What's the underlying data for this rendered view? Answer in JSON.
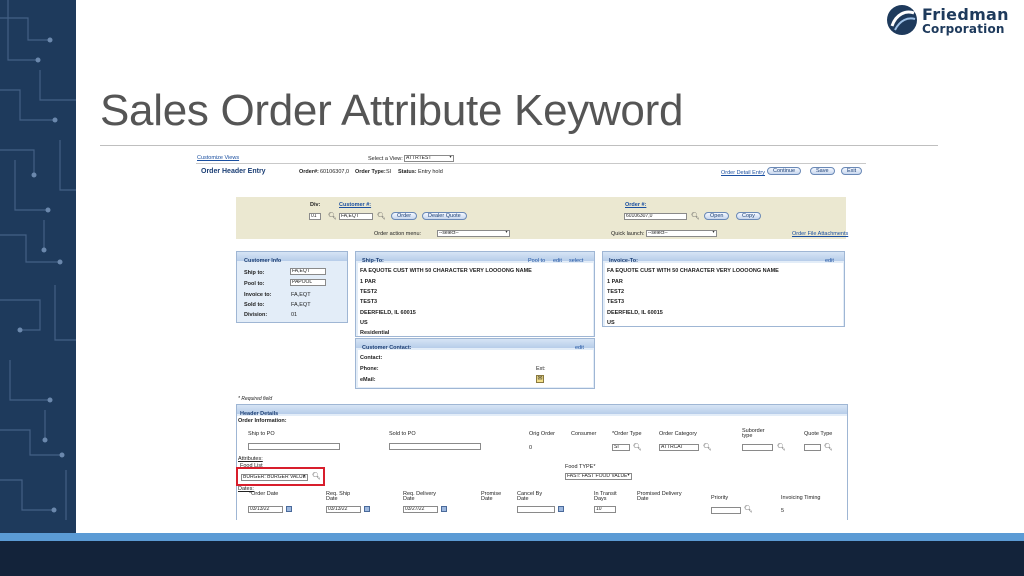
{
  "slide": {
    "title": "Sales Order Attribute Keyword",
    "logo_line1": "Friedman",
    "logo_line2": "Corporation",
    "colors": {
      "band": "#1e3a5c",
      "accent": "#5b9bd5",
      "footer": "#13233a",
      "highlight": "#d81e2c"
    }
  },
  "topbar": {
    "customize_views": "Customize Views",
    "select_view_label": "Select a View:",
    "select_view_value": "ATTRTEST"
  },
  "header": {
    "title": "Order Header Entry",
    "order_no_label": "Order#:",
    "order_no": "60106307,0",
    "order_type_label": "Order Type:",
    "order_type": "SI",
    "status_label": "Status:",
    "status": "Entry hold",
    "detail_link": "Order Detail Entry",
    "continue": "Continue",
    "save": "Save",
    "exit": "Exit"
  },
  "top_form": {
    "div_label": "Div:",
    "div_value": "01",
    "customer_label": "Customer #:",
    "customer_value": "FA,EQT",
    "order_button": "Order",
    "dealer_quote_button": "Dealer Quote",
    "order_num_label": "Order #:",
    "order_num_value": "60106307,0",
    "open_button": "Open",
    "copy_button": "Copy",
    "action_menu_label": "Order action menu:",
    "action_menu_value": "--select--",
    "quick_launch_label": "Quick launch:",
    "quick_launch_value": "--select--",
    "file_attachments": "Order File Attachments"
  },
  "customer_info": {
    "title": "Customer Info",
    "ship_to_label": "Ship to:",
    "ship_to": "FA,EQT",
    "pool_to_label": "Pool to:",
    "pool_to": "PAPOOL",
    "invoice_to_label": "Invoice to:",
    "invoice_to": "FA,EQT",
    "sold_to_label": "Sold to:",
    "sold_to": "FA,EQT",
    "division_label": "Division:",
    "division": "01"
  },
  "ship_to": {
    "title": "Ship-To:",
    "pool_to": "Pool to",
    "edit": "edit",
    "select": "select",
    "lines": [
      "FA EQUOTE CUST WITH 50 CHARACTER VERY LOOOONG NAME",
      "1 PAR",
      "TEST2",
      "TEST3",
      "DEERFIELD, IL 60015",
      "US",
      "Residential"
    ]
  },
  "customer_contact": {
    "title": "Customer Contact:",
    "edit": "edit",
    "contact_label": "Contact:",
    "phone_label": "Phone:",
    "ext_label": "Ext:",
    "email_label": "eMail:"
  },
  "invoice_to": {
    "title": "Invoice-To:",
    "edit": "edit",
    "lines": [
      "FA EQUOTE CUST WITH 50 CHARACTER VERY LOOOONG NAME",
      "1 PAR",
      "TEST2",
      "TEST3",
      "DEERFIELD, IL 60015",
      "US"
    ]
  },
  "required_note": "* Required field",
  "header_details": {
    "title": "Header Details",
    "order_info": "Order Information:",
    "ship_to_po": "Ship to PO",
    "sold_to_po": "Sold to PO",
    "orig_order": "Orig Order",
    "orig_order_value": "0",
    "consumer": "Consumer",
    "order_type": "*Order Type",
    "order_type_value": "SI",
    "order_category": "Order Category",
    "order_category_value": "ATTRCAT",
    "suborder_type": "Suborder type",
    "quote_type": "Quote Type",
    "attributes": "Attributes:",
    "food_list_label": "Food List",
    "food_list_value": "BURGER: BURGER VALUE",
    "food_type_label": "Food TYPE*",
    "food_type_value": "FAST: FAST FOOD VALUE",
    "dates": "Dates:",
    "order_date_label": "*Order Date",
    "order_date": "03/13/22",
    "req_ship_label": "Req. Ship Date",
    "req_ship": "03/13/22",
    "req_delivery_label": "Req. Delivery Date",
    "req_delivery": "03/27/22",
    "promise_label": "Promise Date",
    "cancel_by_label": "Cancel By Date",
    "in_transit_label": "In Transit Days",
    "in_transit": "10",
    "promised_delivery_label": "Promised Delivery Date",
    "priority_label": "Priority",
    "invoicing_label": "Invoicing Timing",
    "invoicing_value": "5"
  }
}
